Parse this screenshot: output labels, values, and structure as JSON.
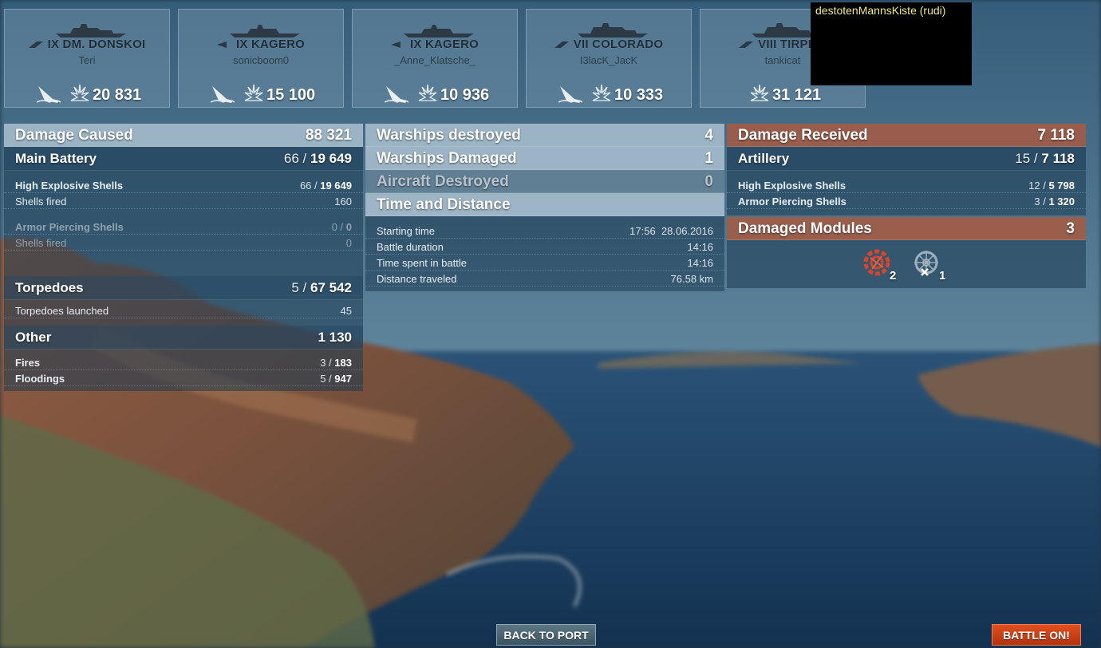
{
  "ships": [
    {
      "tier_name": "IX DM. DONSKOI",
      "player": "Teri",
      "damage": "20 831",
      "sunk_icon": true
    },
    {
      "tier_name": "IX KAGERO",
      "player": "sonicboom0",
      "damage": "15 100",
      "sunk_icon": true
    },
    {
      "tier_name": "IX KAGERO",
      "player": "_Anne_Klatsche_",
      "damage": "10 936",
      "sunk_icon": true
    },
    {
      "tier_name": "VII COLORADO",
      "player": "I3lacK_JacK",
      "damage": "10 333",
      "sunk_icon": true
    },
    {
      "tier_name": "VIII TIRPITZ",
      "player": "tankicat",
      "damage": "31 121",
      "sunk_icon": false
    }
  ],
  "overlay_label": "destotenMannsKiste (rudi)",
  "damage_caused": {
    "label": "Damage Caused",
    "value": "88 321",
    "main_battery": {
      "label": "Main Battery",
      "hits": "66 / ",
      "value": "19 649"
    },
    "he_shells": {
      "label": "High Explosive Shells",
      "hits": "66 / ",
      "value": "19 649"
    },
    "he_fired": {
      "label": "Shells fired",
      "value": "160"
    },
    "ap_shells": {
      "label": "Armor Piercing Shells",
      "hits": "0 / ",
      "value": "0"
    },
    "ap_fired": {
      "label": "Shells fired",
      "value": "0"
    },
    "torpedoes": {
      "label": "Torpedoes",
      "hits": "5 / ",
      "value": "67 542"
    },
    "torp_launched": {
      "label": "Torpedoes launched",
      "value": "45"
    },
    "other": {
      "label": "Other",
      "value": "1 130"
    },
    "fires": {
      "label": "Fires",
      "hits": "3 / ",
      "value": "183"
    },
    "floodings": {
      "label": "Floodings",
      "hits": "5 / ",
      "value": "947"
    }
  },
  "middle": {
    "destroyed": {
      "label": "Warships destroyed",
      "value": "4"
    },
    "damaged": {
      "label": "Warships Damaged",
      "value": "1"
    },
    "aircraft": {
      "label": "Aircraft Destroyed",
      "value": "0"
    },
    "time_title": "Time and Distance",
    "start": {
      "label": "Starting time",
      "value": "17:56  28.06.2016"
    },
    "duration": {
      "label": "Battle duration",
      "value": "14:16"
    },
    "spent": {
      "label": "Time spent in battle",
      "value": "14:16"
    },
    "distance": {
      "label": "Distance traveled",
      "value": "76.58 km"
    }
  },
  "received": {
    "label": "Damage Received",
    "value": "7 118",
    "artillery": {
      "label": "Artillery",
      "hits": "15 / ",
      "value": "7 118"
    },
    "he": {
      "label": "High Explosive Shells",
      "hits": "12 / ",
      "value": "5 798"
    },
    "ap": {
      "label": "Armor Piercing Shells",
      "hits": "3 / ",
      "value": "1 320"
    },
    "modules": {
      "label": "Damaged Modules",
      "value": "3",
      "engine_count": "2",
      "steering_count": "1"
    }
  },
  "buttons": {
    "back": "BACK TO PORT",
    "battle": "BATTLE ON!"
  },
  "colors": {
    "accent_red": "#a05c46",
    "battle_button": "#c9401a"
  }
}
